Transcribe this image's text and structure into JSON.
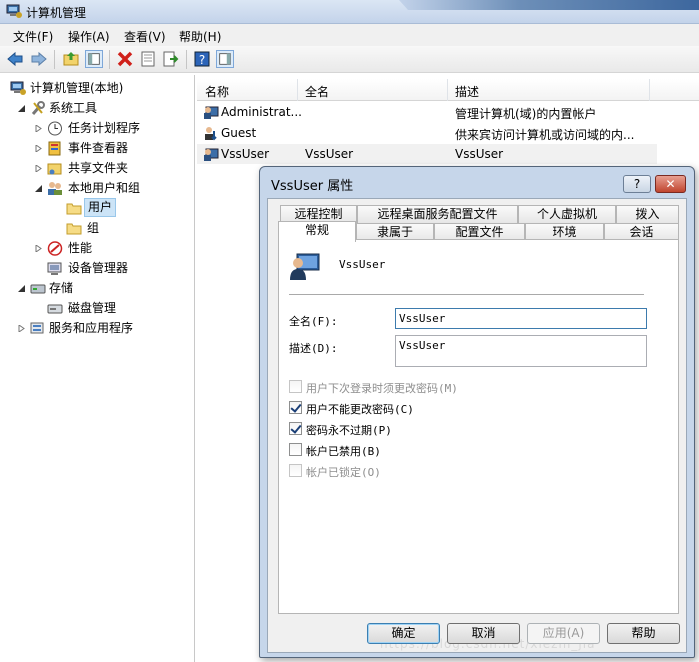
{
  "window": {
    "title": "计算机管理"
  },
  "menu": [
    "文件(F)",
    "操作(A)",
    "查看(V)",
    "帮助(H)"
  ],
  "tree": [
    {
      "label": "计算机管理(本地)",
      "icon": "computer-management-icon"
    },
    {
      "label": "系统工具",
      "icon": "tools-icon"
    },
    {
      "label": "任务计划程序",
      "icon": "clock-icon"
    },
    {
      "label": "事件查看器",
      "icon": "event-viewer-icon"
    },
    {
      "label": "共享文件夹",
      "icon": "shared-folder-icon"
    },
    {
      "label": "本地用户和组",
      "icon": "users-icon"
    },
    {
      "label": "用户",
      "icon": "folder-icon"
    },
    {
      "label": "组",
      "icon": "folder-icon"
    },
    {
      "label": "性能",
      "icon": "performance-icon"
    },
    {
      "label": "设备管理器",
      "icon": "device-manager-icon"
    },
    {
      "label": "存储",
      "icon": "storage-icon"
    },
    {
      "label": "磁盘管理",
      "icon": "disk-icon"
    },
    {
      "label": "服务和应用程序",
      "icon": "services-icon"
    }
  ],
  "list": {
    "headers": [
      "名称",
      "全名",
      "描述"
    ],
    "rows": [
      {
        "name": "Administrat...",
        "fullname": "",
        "desc": "管理计算机(域)的内置帐户"
      },
      {
        "name": "Guest",
        "fullname": "",
        "desc": "供来宾访问计算机或访问域的内..."
      },
      {
        "name": "VssUser",
        "fullname": "VssUser",
        "desc": "VssUser"
      }
    ]
  },
  "dialog": {
    "title": "VssUser 属性",
    "help_button": "?",
    "close_button": "✕",
    "tabs_top": [
      "远程控制",
      "远程桌面服务配置文件",
      "个人虚拟机",
      "拨入"
    ],
    "tabs_bottom": [
      "常规",
      "隶属于",
      "配置文件",
      "环境",
      "会话"
    ],
    "username": "VssUser",
    "fullname_label": "全名(F):",
    "fullname_value": "VssUser",
    "desc_label": "描述(D):",
    "desc_value": "VssUser",
    "checkboxes": [
      {
        "label": "用户下次登录时须更改密码(M)",
        "checked": false,
        "disabled": true
      },
      {
        "label": "用户不能更改密码(C)",
        "checked": true,
        "disabled": false
      },
      {
        "label": "密码永不过期(P)",
        "checked": true,
        "disabled": false
      },
      {
        "label": "帐户已禁用(B)",
        "checked": false,
        "disabled": false
      },
      {
        "label": "帐户已锁定(O)",
        "checked": false,
        "disabled": true
      }
    ],
    "buttons": {
      "ok": "确定",
      "cancel": "取消",
      "apply": "应用(A)",
      "help": "帮助"
    }
  },
  "watermark": "https://blog.csdn.net/xiezhi_jia"
}
